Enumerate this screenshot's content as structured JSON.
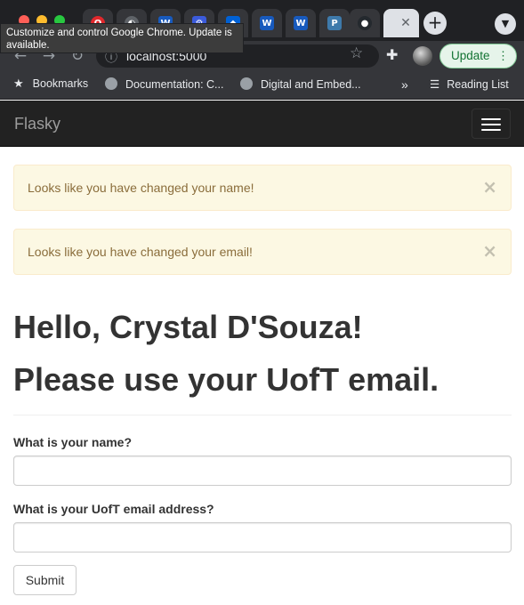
{
  "browser": {
    "tooltip": "Customize and control Google Chrome. Update is available.",
    "tabs": [
      {
        "icon": "opera-red-icon",
        "color": "#e0282c",
        "glyph": "O"
      },
      {
        "icon": "circle-half-icon",
        "color": "#5f6368",
        "glyph": "◐"
      },
      {
        "icon": "word-icon",
        "color": "#185abd",
        "glyph": "W"
      },
      {
        "icon": "app-blue-icon",
        "color": "#3b5bdb",
        "glyph": "⚙"
      },
      {
        "icon": "box-blue-icon",
        "color": "#0061d5",
        "glyph": "◆"
      },
      {
        "icon": "word-icon",
        "color": "#185abd",
        "glyph": "W"
      },
      {
        "icon": "word-icon",
        "color": "#185abd",
        "glyph": "W"
      },
      {
        "icon": "piazza-icon",
        "color": "#3e7aab",
        "glyph": "P"
      },
      {
        "icon": "github-icon",
        "color": "#24292e",
        "glyph": "●"
      }
    ],
    "address": "localhost:5000",
    "update_label": "Update",
    "bookmarks": [
      {
        "label": "Bookmarks"
      },
      {
        "label": "Documentation: C..."
      },
      {
        "label": "Digital and Embed..."
      }
    ],
    "overflow": "»",
    "reading_list": "Reading List"
  },
  "navbar": {
    "brand": "Flasky"
  },
  "alerts": [
    {
      "text": "Looks like you have changed your name!",
      "close": "×"
    },
    {
      "text": "Looks like you have changed your email!",
      "close": "×"
    }
  ],
  "page": {
    "greeting": "Hello, Crystal D'Souza!",
    "subheading": "Please use your UofT email."
  },
  "form": {
    "name_label": "What is your name?",
    "name_value": "",
    "email_label": "What is your UofT email address?",
    "email_value": "",
    "submit_label": "Submit"
  },
  "colors": {
    "alert_bg": "#fcf8e3",
    "alert_text": "#8a6d3b",
    "navbar_bg": "#222222",
    "update_green": "#137333"
  }
}
